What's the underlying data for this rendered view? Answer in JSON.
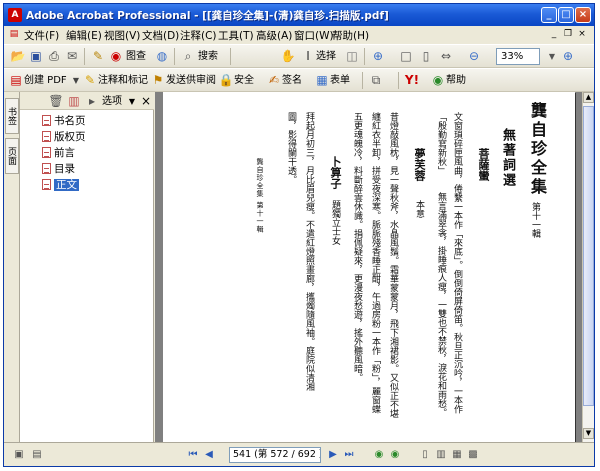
{
  "window": {
    "title": "Adobe Acrobat Professional - [[龚自珍全集]-(清)龚自珍.扫描版.pdf]"
  },
  "menubar": {
    "items": [
      "文件(F)",
      "编辑(E)",
      "视图(V)",
      "文档(D)",
      "注释(C)",
      "工具(T)",
      "高级(A)",
      "窗口(W)",
      "帮助(H)"
    ]
  },
  "toolbar1": {
    "create_pdf_label": "图查",
    "search_label": "搜索",
    "select_label": "选择",
    "zoom_value": "33%"
  },
  "toolbar2": {
    "create_pdf": "创建 PDF",
    "comment": "注释和标记",
    "send_review": "发送供审阅",
    "secure": "安全",
    "sign": "签名",
    "forms": "表单",
    "help": "帮助"
  },
  "sidetabs": [
    "书签",
    "页面"
  ],
  "bookmarks_panel": {
    "options_label": "选项",
    "items": [
      "书名页",
      "版权页",
      "前言",
      "目录",
      "正文"
    ],
    "selected_index": 4
  },
  "page_text": {
    "book_title": "龔自珍全集",
    "volume": "第十一輯",
    "section": "無著詞選",
    "poem1_title": "菩薩蠻",
    "poem1_lines": [
      "文窗瑣碎匣風曲，倦繫一本作「來底」。倒倒倚屏倚笛。秋旦正沉吟，一本作",
      "「殷勤寫新秋」",
      "無言滿翠衾，掛睡痕人瘦，一雙也不禁秋，淚花和雨愁。"
    ],
    "poem2_title": "夢芙蓉",
    "poem2_note": "本意",
    "poem2_lines": [
      "昔燈敲風枕，見一聲秋斧，水晶風鬚。霜華蒙蒙月，飛下湘裙影。又似正不堪",
      "纏紅衣半卸，拼受夜深寒。脈脈殘香睡正酣，午過房粉一本作「粉」，麗窗蝶",
      "五更魂魄冷，料斷醉雲休識。捐佩疑來，更漫夜愁遊，搖外聽風暗。"
    ],
    "poem3_title": "卜算子",
    "poem3_note": "題獨立士女",
    "poem3_lines": [
      "拜起月初三，月比眉兒瘦。不遣紅燈照畫廊，攜燭隨風袖。庭院似清湘",
      "圖，影得闌干透。"
    ],
    "footer": "龔自珍全集 第十一輯"
  },
  "statusbar": {
    "page_field": "541 (第 572 / 692 页)"
  },
  "colors": {
    "title_bar": "#1a5ad6",
    "selection": "#316ac5",
    "doc_background": "#808080"
  }
}
